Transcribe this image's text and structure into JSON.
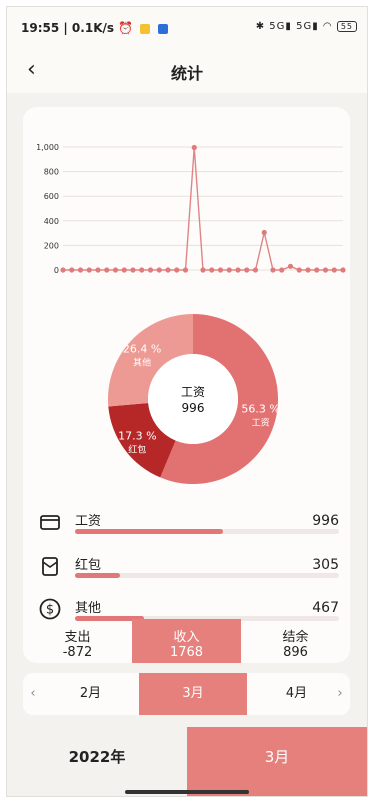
{
  "status": {
    "time": "19:55 | 0.1K/s",
    "battery": "55",
    "signal": "✱ 5G▮ 5G▮ ◠"
  },
  "header": {
    "title": "统计"
  },
  "chart_data": {
    "type": "line",
    "yticks": [
      "1,000",
      "800",
      "600",
      "400",
      "200",
      "0"
    ],
    "ylim": [
      0,
      1000
    ],
    "values": [
      0,
      0,
      0,
      0,
      0,
      0,
      0,
      0,
      0,
      0,
      0,
      0,
      0,
      0,
      0,
      996,
      0,
      0,
      0,
      0,
      0,
      0,
      0,
      305,
      0,
      0,
      30,
      0,
      0,
      0,
      0,
      0,
      0
    ]
  },
  "donut": {
    "center_label": "工资",
    "center_value": "996",
    "slices": [
      {
        "name": "工资",
        "percent": "56.3 %",
        "value": 56.3,
        "color": "#e27272"
      },
      {
        "name": "红包",
        "percent": "17.3 %",
        "value": 17.3,
        "color": "#b62828"
      },
      {
        "name": "其他",
        "percent": "26.4 %",
        "value": 26.4,
        "color": "#ec9a93"
      }
    ]
  },
  "categories": [
    {
      "name": "工资",
      "amount": "996",
      "fill": 0.56,
      "icon": "wallet-icon"
    },
    {
      "name": "红包",
      "amount": "305",
      "fill": 0.17,
      "icon": "red-envelope-icon"
    },
    {
      "name": "其他",
      "amount": "467",
      "fill": 0.26,
      "icon": "dollar-icon"
    }
  ],
  "summary": [
    {
      "label": "支出",
      "value": "-872"
    },
    {
      "label": "收入",
      "value": "1768"
    },
    {
      "label": "结余",
      "value": "896"
    }
  ],
  "months": {
    "prev": "2月",
    "current": "3月",
    "next": "4月"
  },
  "bottom": {
    "year": "2022年",
    "month": "3月"
  },
  "colors": {
    "accent": "#e5807c"
  }
}
